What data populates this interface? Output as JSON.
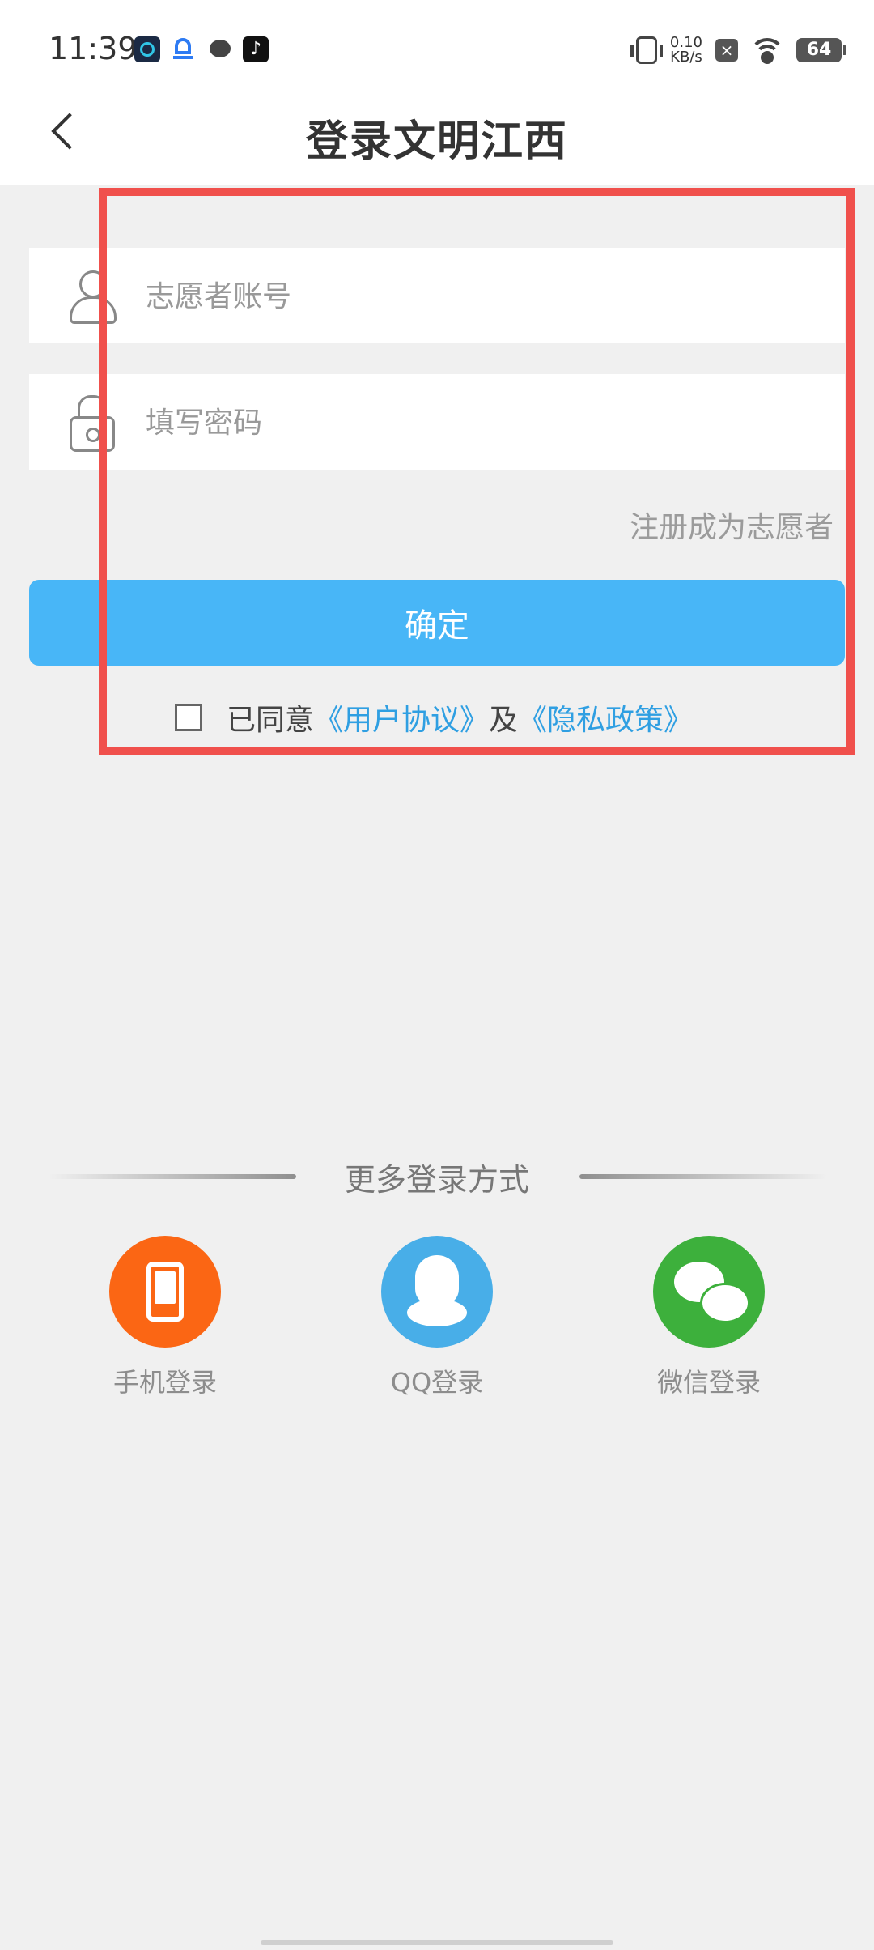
{
  "status_bar": {
    "time": "11:39",
    "net_speed_value": "0.10",
    "net_speed_unit": "KB/s",
    "battery": "64",
    "notif_icons": [
      "cc-app-icon",
      "bus-app-icon",
      "message-icon",
      "tiktok-icon"
    ]
  },
  "header": {
    "title": "登录文明江西"
  },
  "form": {
    "account_placeholder": "志愿者账号",
    "password_placeholder": "填写密码",
    "register_label": "注册成为志愿者",
    "confirm_label": "确定",
    "agree_prefix": "已同意",
    "user_agreement": "《用户协议》",
    "agree_and": "及",
    "privacy_policy": "《隐私政策》"
  },
  "more_login": {
    "title": "更多登录方式",
    "options": [
      {
        "label": "手机登录",
        "icon": "phone-icon",
        "color": "#fb6614"
      },
      {
        "label": "QQ登录",
        "icon": "qq-icon",
        "color": "#48aee8"
      },
      {
        "label": "微信登录",
        "icon": "wechat-icon",
        "color": "#3db03c"
      }
    ]
  },
  "colors": {
    "accent": "#48b6f7",
    "link": "#2f9fe2",
    "highlight": "#f0504c"
  }
}
